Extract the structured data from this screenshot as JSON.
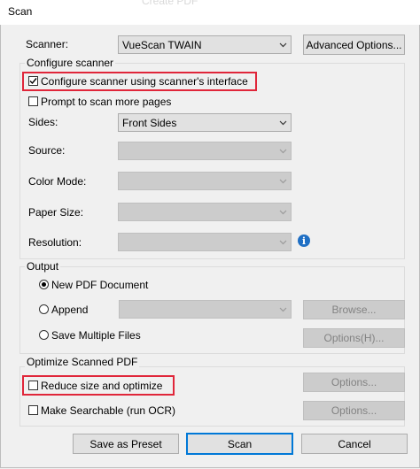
{
  "window": {
    "title": "Scan",
    "ghost_text": "Create PDF"
  },
  "scanner": {
    "label": "Scanner:",
    "value": "VueScan TWAIN",
    "advanced_button": "Advanced Options..."
  },
  "configure": {
    "group_title": "Configure scanner",
    "use_interface_label": "Configure scanner using scanner's interface",
    "use_interface_checked": true,
    "prompt_label": "Prompt to scan more pages",
    "prompt_checked": false,
    "sides_label": "Sides:",
    "sides_value": "Front Sides",
    "source_label": "Source:",
    "color_mode_label": "Color Mode:",
    "paper_size_label": "Paper Size:",
    "resolution_label": "Resolution:",
    "info_glyph": "i"
  },
  "output": {
    "group_title": "Output",
    "new_pdf_label": "New PDF Document",
    "append_label": "Append",
    "browse_button": "Browse...",
    "save_multiple_label": "Save Multiple Files",
    "options_button": "Options(H)...",
    "selected": "New PDF Document"
  },
  "optimize": {
    "group_title": "Optimize Scanned PDF",
    "reduce_label": "Reduce size and optimize",
    "reduce_checked": false,
    "reduce_options_button": "Options...",
    "ocr_label": "Make Searchable (run OCR)",
    "ocr_checked": false,
    "ocr_options_button": "Options..."
  },
  "footer": {
    "preset_button": "Save as Preset",
    "scan_button": "Scan",
    "cancel_button": "Cancel"
  },
  "colors": {
    "highlight": "#e0263a",
    "accent": "#0078d7",
    "info": "#1f6fc4"
  }
}
